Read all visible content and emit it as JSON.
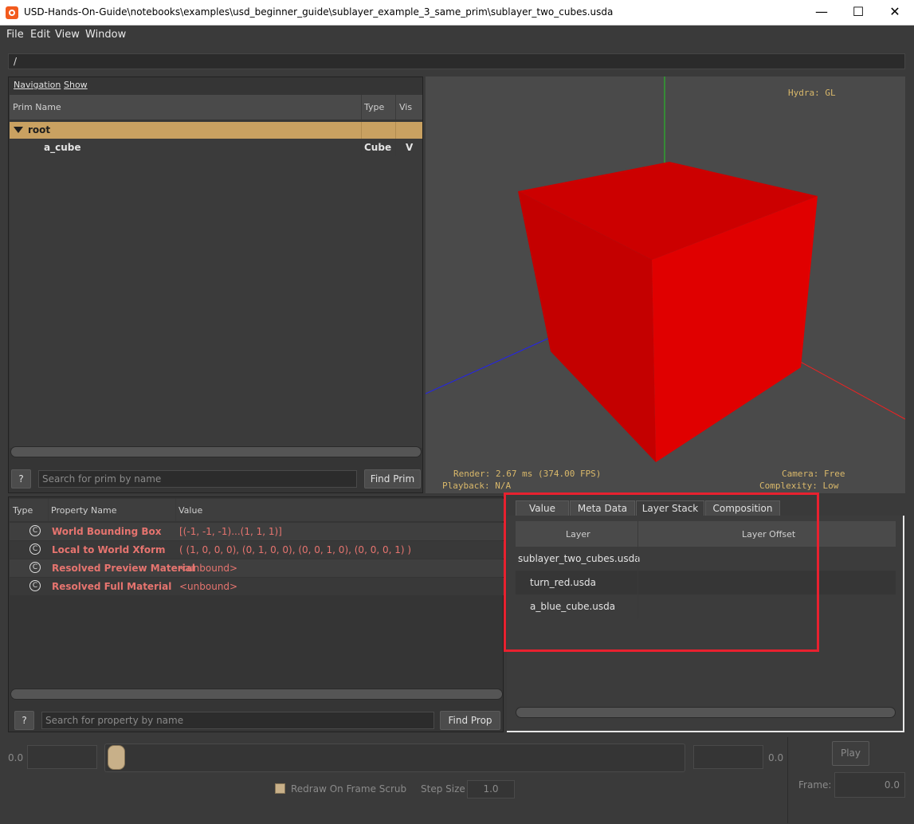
{
  "window": {
    "title": "USD-Hands-On-Guide\\notebooks\\examples\\usd_beginner_guide\\sublayer_example_3_same_prim\\sublayer_two_cubes.usda",
    "minimize": "—",
    "maximize": "☐",
    "close": "✕"
  },
  "menu": [
    "File",
    "Edit",
    "View",
    "Window"
  ],
  "path": "/",
  "prim_browser": {
    "nav": [
      "Navigation",
      "Show"
    ],
    "columns": [
      "Prim Name",
      "Type",
      "Vis"
    ],
    "rows": [
      {
        "name": "root",
        "type": "",
        "vis": ""
      },
      {
        "name": "a_cube",
        "type": "Cube",
        "vis": "V"
      }
    ],
    "search_placeholder": "Search for prim by name",
    "help_label": "?",
    "find_label": "Find Prim"
  },
  "viewport": {
    "renderer": "Hydra: GL",
    "render_stats": "Render: 2.67 ms (374.00 FPS)",
    "playback": "Playback: N/A",
    "camera": "Camera: Free",
    "complexity": "Complexity: Low",
    "cube_color": "#d40000"
  },
  "properties": {
    "columns": [
      "Type",
      "Property Name",
      "Value"
    ],
    "rows": [
      {
        "icon": "C",
        "name": "World Bounding Box",
        "value": "[(-1, -1, -1)...(1, 1, 1)]"
      },
      {
        "icon": "C",
        "name": "Local to World Xform",
        "value": "( (1, 0, 0, 0), (0, 1, 0, 0), (0, 0, 1, 0), (0, 0, 0, 1) )"
      },
      {
        "icon": "C",
        "name": "Resolved Preview Material",
        "value": "<unbound>"
      },
      {
        "icon": "C",
        "name": "Resolved Full Material",
        "value": "<unbound>"
      }
    ],
    "search_placeholder": "Search for property by name",
    "help_label": "?",
    "find_label": "Find Prop"
  },
  "layer_stack": {
    "tabs": [
      "Value",
      "Meta Data",
      "Layer Stack",
      "Composition"
    ],
    "active_tab": "Layer Stack",
    "columns": [
      "Layer",
      "Layer Offset"
    ],
    "rows": [
      "sublayer_two_cubes.usda",
      "turn_red.usda",
      "a_blue_cube.usda"
    ]
  },
  "timeline": {
    "start_value": "0.0",
    "end_value": "0.0",
    "play_label": "Play",
    "redraw_label": "Redraw On Frame Scrub",
    "step_label": "Step Size",
    "step_value": "1.0",
    "frame_label": "Frame:",
    "frame_value": "0.0"
  },
  "colors": {
    "highlight": "#e8212f",
    "selected_row": "#c9a161",
    "property_text": "#e6746f",
    "hud_text": "#d9b86a"
  }
}
